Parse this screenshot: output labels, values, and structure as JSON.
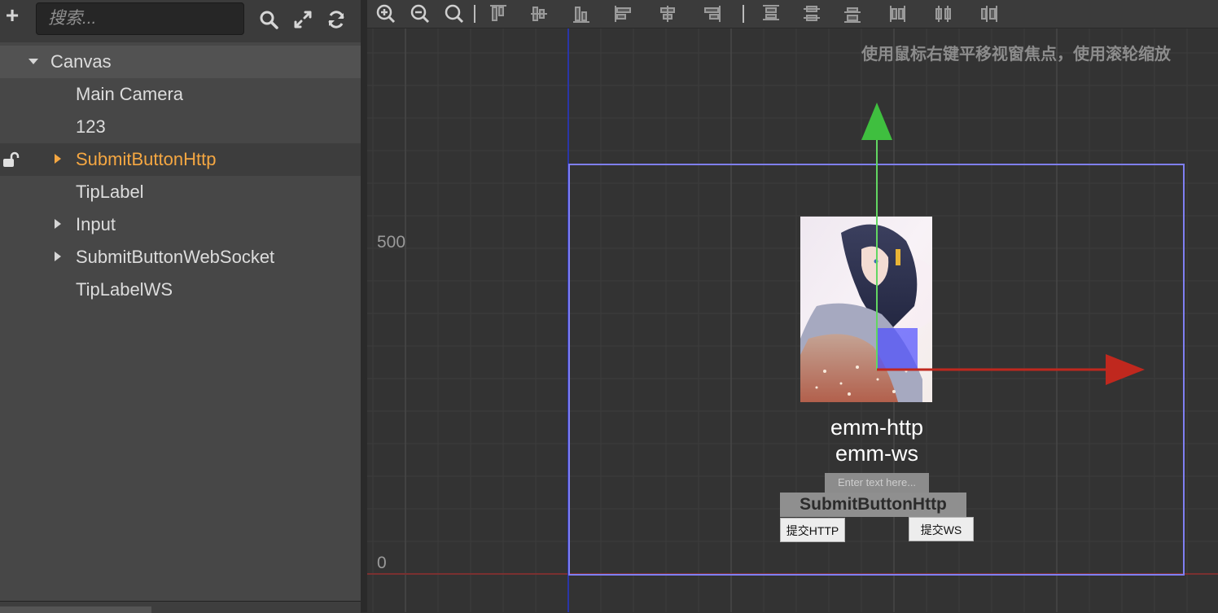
{
  "hierarchy": {
    "add_icon": "plus-icon",
    "search_placeholder": "搜索...",
    "tools": [
      "search-icon",
      "expand-icon",
      "refresh-icon"
    ],
    "items": [
      {
        "label": "Canvas",
        "expanded": true,
        "level": 0
      },
      {
        "label": "Main Camera",
        "level": 1
      },
      {
        "label": "123",
        "level": 1
      },
      {
        "label": "SubmitButtonHttp",
        "level": 1,
        "collapsed": true,
        "selected": true,
        "locked": false
      },
      {
        "label": "TipLabel",
        "level": 1
      },
      {
        "label": "Input",
        "level": 1,
        "collapsed": true
      },
      {
        "label": "SubmitButtonWebSocket",
        "level": 1,
        "collapsed": true
      },
      {
        "label": "TipLabelWS",
        "level": 1
      }
    ]
  },
  "scene": {
    "toolbar": {
      "zoom_tools": [
        "zoom-in-icon",
        "zoom-out-icon",
        "zoom-reset-icon"
      ],
      "align_tools": [
        "align-top-icon",
        "align-vcenter-icon",
        "align-bottom-icon",
        "align-left-icon",
        "align-hcenter-icon",
        "align-right-icon"
      ],
      "distribute_tools": [
        "distribute-top-icon",
        "distribute-vcenter-icon",
        "distribute-bottom-icon",
        "distribute-left-icon",
        "distribute-hcenter-icon",
        "distribute-right-icon"
      ]
    },
    "hint": "使用鼠标右键平移视窗焦点，使用滚轮缩放",
    "y_labels": [
      "500",
      "0"
    ],
    "canvas": {
      "tip_label": "emm-http",
      "tip_label_ws": "emm-ws",
      "input_placeholder": "Enter text here...",
      "selected_node_tag": "SubmitButtonHttp",
      "http_button": "提交HTTP",
      "ws_button": "提交WS"
    },
    "colors": {
      "selection": "#f5a742",
      "design_frame": "#7f7ff2",
      "gizmo_y": "#3fbf3f",
      "gizmo_x": "#c0281e"
    }
  }
}
